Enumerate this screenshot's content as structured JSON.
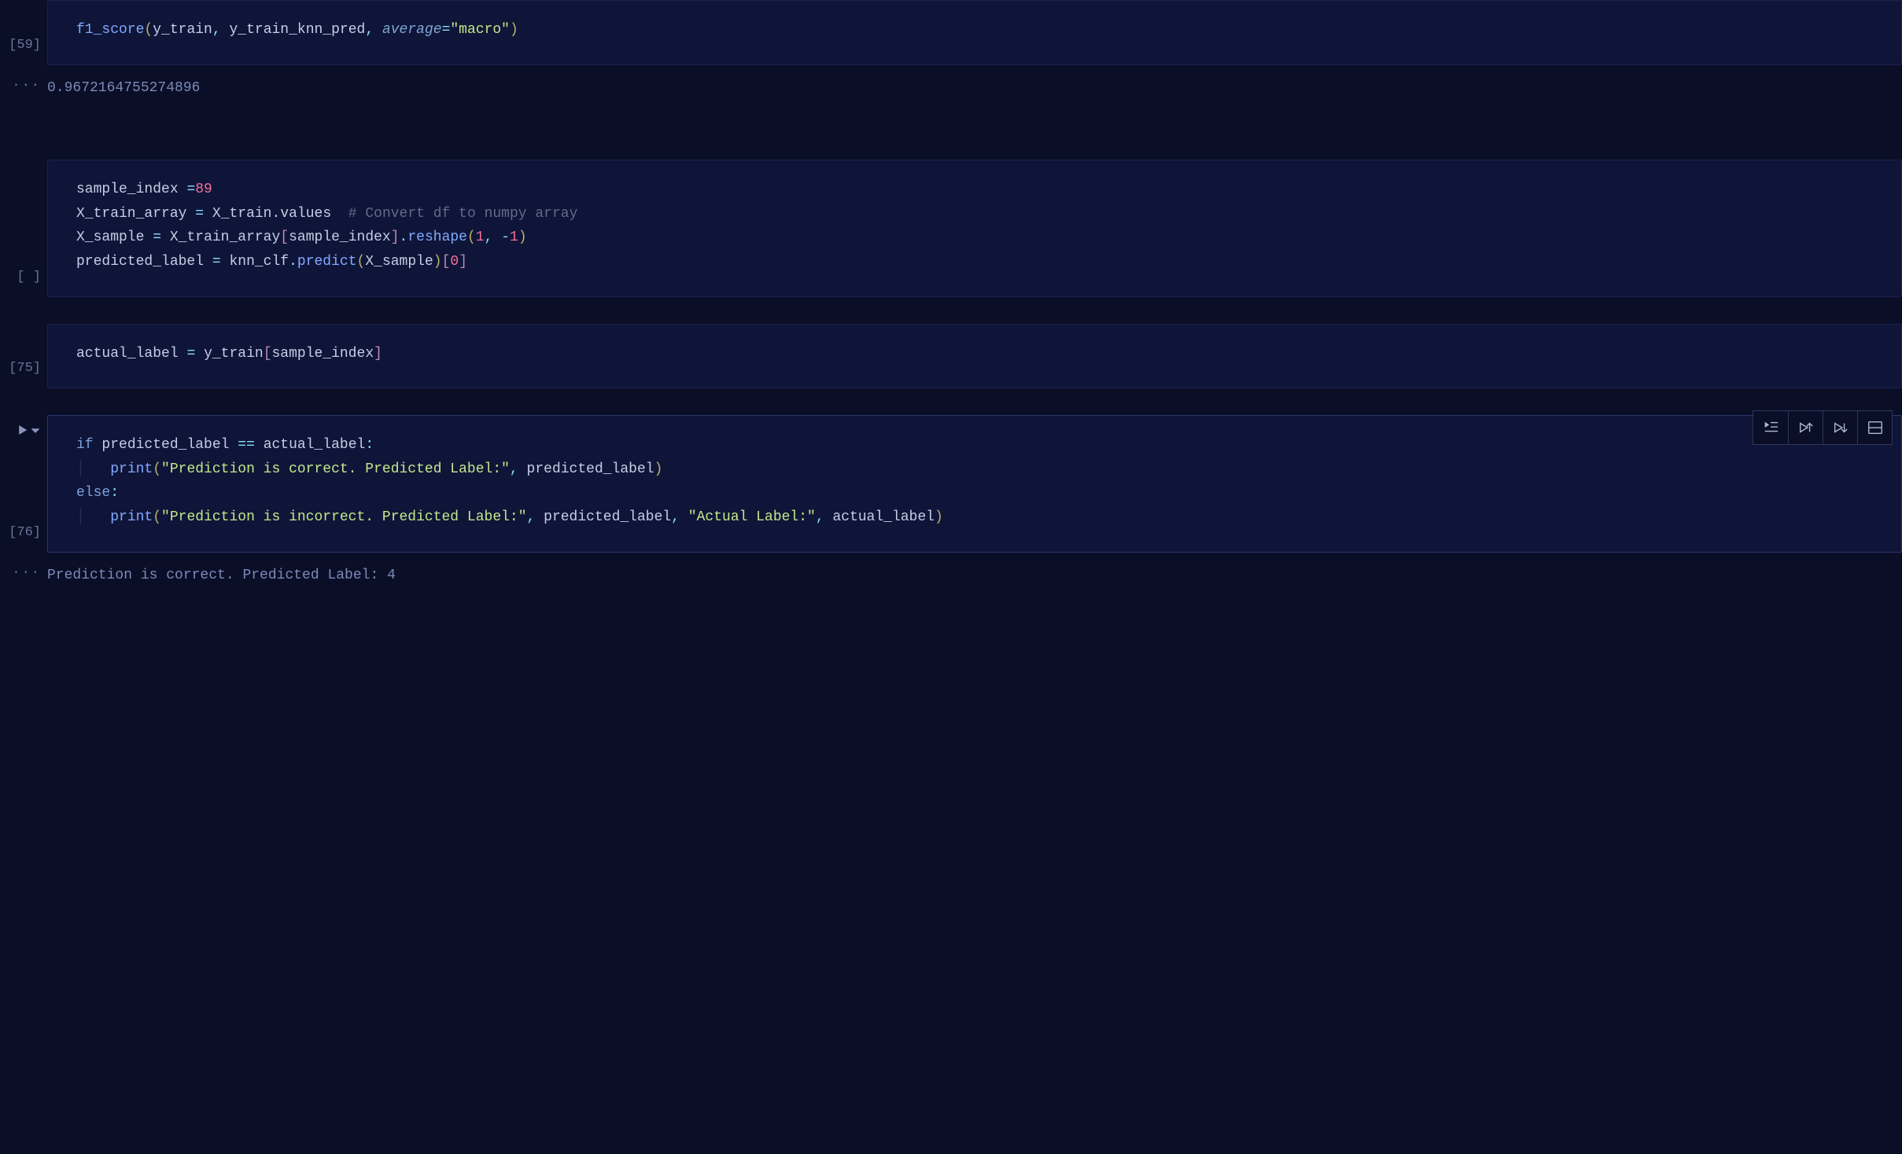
{
  "cells": {
    "c59": {
      "exec_label": "[59]",
      "out_label": "...",
      "code": {
        "fn": "f1_score",
        "arg1": "y_train",
        "arg2": "y_train_knn_pred",
        "kw": "average",
        "kwval": "\"macro\""
      },
      "output": "0.9672164755274896"
    },
    "cSample": {
      "exec_label": "[ ]",
      "line1": {
        "lhs": "sample_index",
        "op": "=",
        "val": "89"
      },
      "line2": {
        "lhs": "X_train_array",
        "op": "=",
        "rhs_obj": "X_train",
        "rhs_attr": "values",
        "comment": "# Convert df to numpy array"
      },
      "line3": {
        "lhs": "X_sample",
        "op": "=",
        "obj": "X_train_array",
        "idx": "sample_index",
        "method": "reshape",
        "a1": "1",
        "a2": "-1"
      },
      "line4": {
        "lhs": "predicted_label",
        "op": "=",
        "obj": "knn_clf",
        "method": "predict",
        "arg": "X_sample",
        "idx": "0"
      }
    },
    "c75": {
      "exec_label": "[75]",
      "line1": {
        "lhs": "actual_label",
        "op": "=",
        "obj": "y_train",
        "idx": "sample_index"
      }
    },
    "c76": {
      "exec_label": "[76]",
      "out_label": "...",
      "kw_if": "if",
      "cond_l": "predicted_label",
      "cond_op": "==",
      "cond_r": "actual_label",
      "print1_str": "\"Prediction is correct. Predicted Label:\"",
      "print1_arg": "predicted_label",
      "kw_else": "else",
      "print2_str": "\"Prediction is incorrect. Predicted Label:\"",
      "print2_arg1": "predicted_label",
      "print2_str2": "\"Actual Label:\"",
      "print2_arg2": "actual_label",
      "print_fn": "print",
      "output": "Prediction is correct. Predicted Label: 4"
    }
  }
}
